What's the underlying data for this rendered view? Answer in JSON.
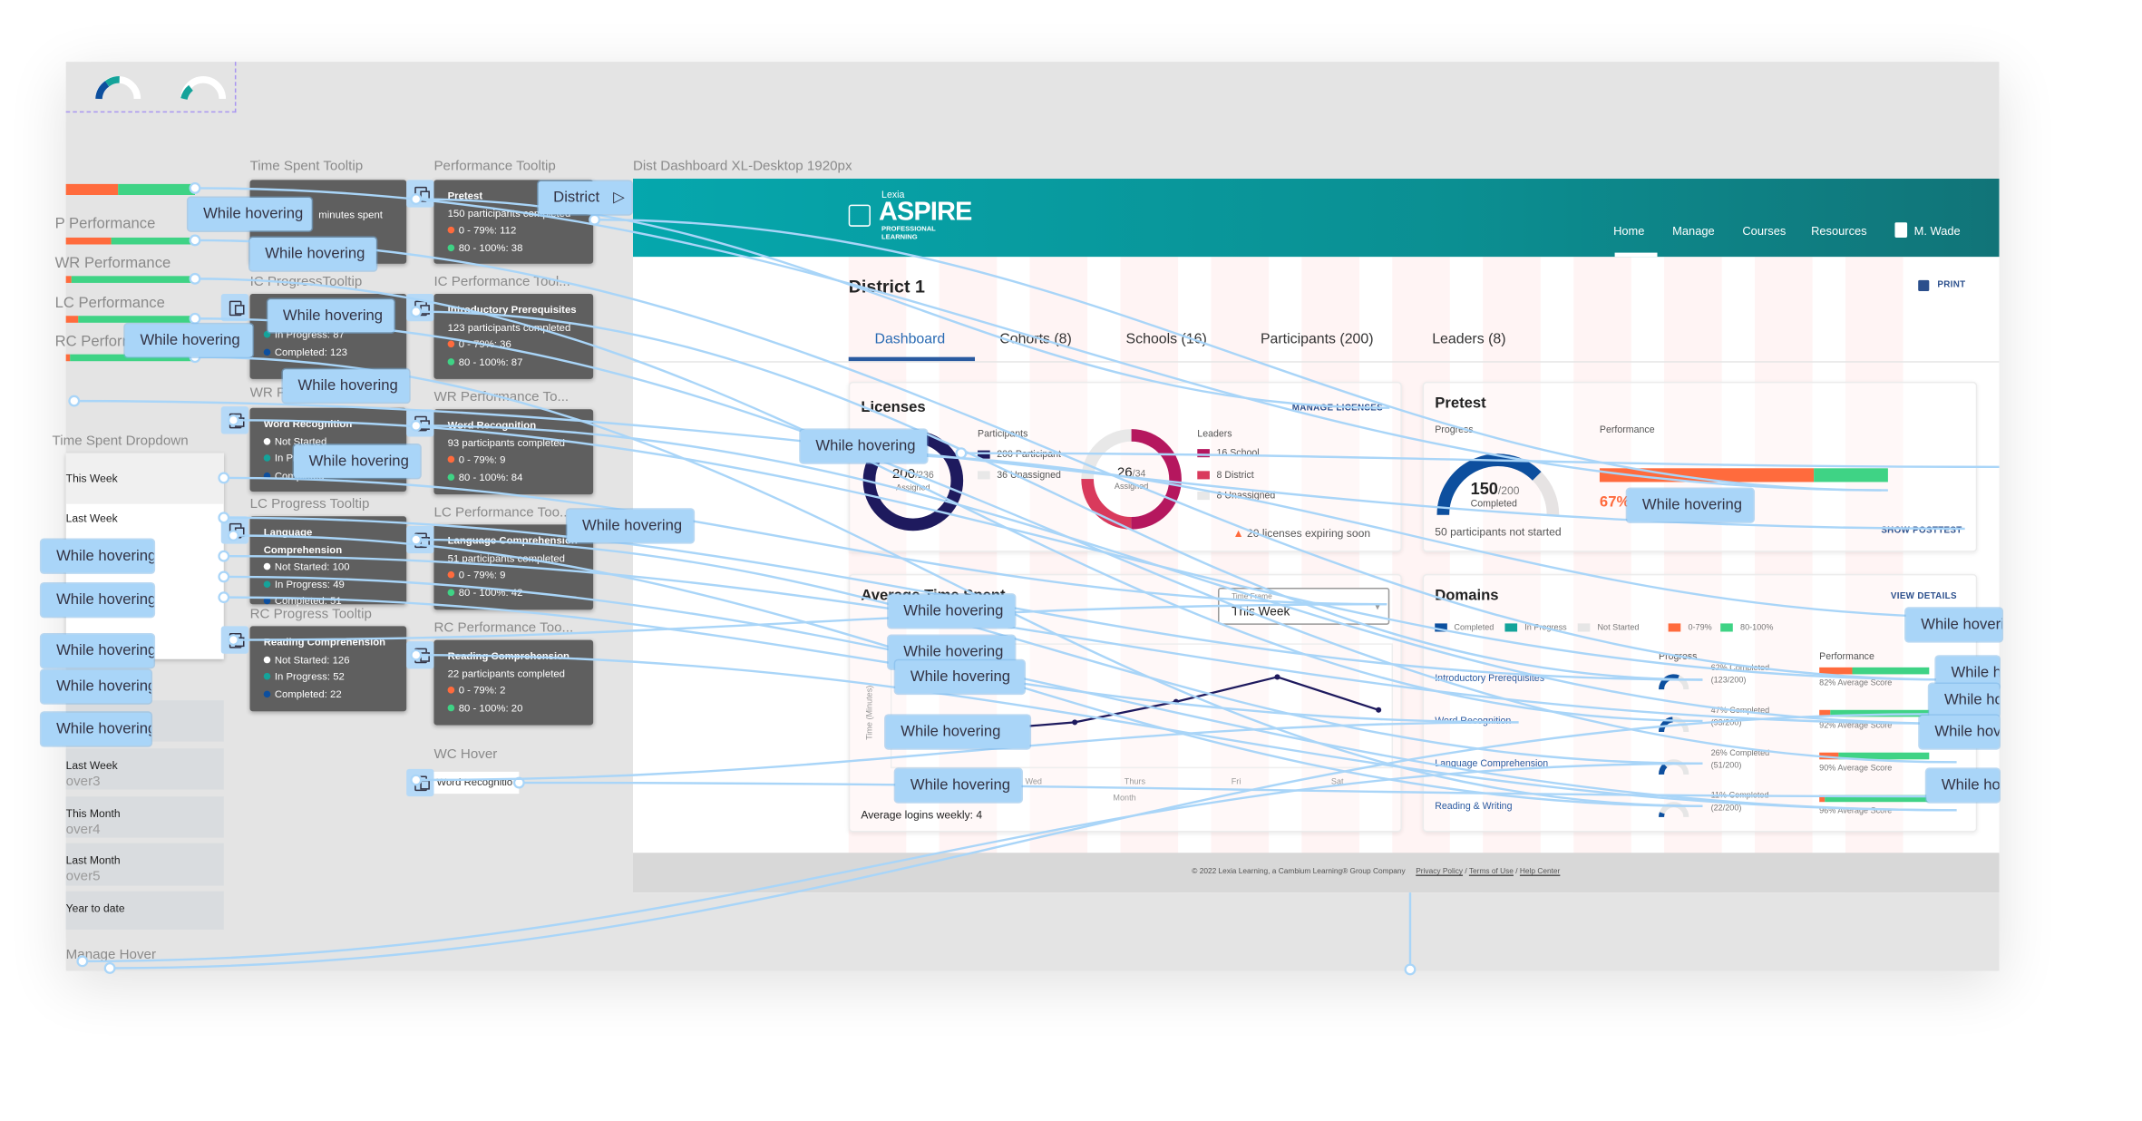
{
  "canvas": {
    "frame_title": "Dist Dashboard XL-Desktop 1920px",
    "hotspot_label": "While hovering",
    "flow_start_label": "District",
    "labels": {
      "time_spent_tooltip": "Time Spent Tooltip",
      "performance_tooltip": "Performance Tooltip",
      "ic_progress_tooltip": "IC ProgressTooltip",
      "ic_performance_tooltip": "IC Performance Tool...",
      "wr_progress_tooltip": "WR Progress Tooltip",
      "wr_performance_tooltip": "WR Performance To...",
      "lc_progress_tooltip": "LC Progress Tooltip",
      "lc_performance_tooltip": "LC Performance Too...",
      "rc_progress_tooltip": "RC Progress Tooltip",
      "rc_performance_tooltip": "RC Performance Too...",
      "wc_hover": "WC Hover",
      "time_spent_dropdown": "Time Spent Dropdown",
      "manage_hover": "Manage Hover",
      "p_performance": "P Performance",
      "wr_performance": "WR Performance",
      "lc_performance": "LC Performance",
      "rc_performance": "RC Performance"
    },
    "tooltips": {
      "time_spent": {
        "line2": "minutes spent"
      },
      "pretest_perf": {
        "title": "Pretest",
        "summary": "150 participants completed",
        "low": "0 - 79%: 112",
        "high": "80 - 100%: 38"
      },
      "ic_progress": {
        "in_progress": "In Progress: 87",
        "completed": "Completed: 123"
      },
      "ic_perf": {
        "title": "Introductory Prerequisites",
        "summary": "123 participants completed",
        "low": "0 - 79%: 36",
        "high": "80 - 100%: 87"
      },
      "wr_progress": {
        "title": "Word Recognition",
        "not_started": "Not Started",
        "in_progress": "In Progress",
        "completed": "Completed"
      },
      "wr_perf": {
        "title": "Word Recognition",
        "summary": "93 participants completed",
        "low": "0 - 79%: 9",
        "high": "80 - 100%: 84"
      },
      "lc_progress": {
        "title": "Language Comprehension",
        "not_started": "Not Started: 100",
        "in_progress": "In Progress: 49",
        "completed": "Completed: 51"
      },
      "lc_perf": {
        "title": "Language Comprehension",
        "summary": "51 participants completed",
        "low": "0 - 79%: 9",
        "high": "80 - 100%: 42"
      },
      "rc_progress": {
        "title": "Reading Comprehension",
        "not_started": "Not Started: 126",
        "in_progress": "In Progress: 52",
        "completed": "Completed: 22"
      },
      "rc_perf": {
        "title": "Reading Comprehension",
        "summary": "22 participants completed",
        "low": "0 - 79%: 2",
        "high": "80 - 100%: 20"
      },
      "wc_hover": {
        "title": "Word Recognitio"
      }
    },
    "dropdown": {
      "items": [
        "This Week",
        "Last Week"
      ]
    },
    "dropdown_rows": [
      {
        "label": "Last Week",
        "sub": "over3"
      },
      {
        "label": "This Month",
        "sub": "over4"
      },
      {
        "label": "Last Month",
        "sub": "over5"
      },
      {
        "label": "Year to date",
        "sub": ""
      }
    ],
    "colors": {
      "hotspot": "#a9d5f8",
      "wire": "#a9d5f8",
      "tooltip_bg": "#5f5f5f"
    }
  },
  "dashboard": {
    "logo": {
      "top": "Lexia",
      "main": "ASPIRE",
      "sub1": "PROFESSIONAL",
      "sub2": "LEARNING"
    },
    "nav": [
      "Home",
      "Manage",
      "Courses",
      "Resources"
    ],
    "user": "M. Wade",
    "page_title": "District 1",
    "print": "PRINT",
    "tabs": [
      "Dashboard",
      "Cohorts (8)",
      "Schools (16)",
      "Participants (200)",
      "Leaders (8)"
    ],
    "active_tab": 0,
    "licenses": {
      "title": "Licenses",
      "manage": "MANAGE LICENSES",
      "participants": {
        "big": "200",
        "total": "/236",
        "caption": "Assigned",
        "legend_title": "Participants",
        "legend": [
          "200 Participant",
          "36 Unassigned"
        ],
        "assigned": 200,
        "of": 236
      },
      "leaders": {
        "big": "26",
        "total": "/34",
        "caption": "Assigned",
        "legend_title": "Leaders",
        "legend": [
          "16 School",
          "8 District",
          "8 Unassigned"
        ],
        "values": [
          16,
          8,
          8
        ]
      },
      "warning": "20 licenses expiring soon"
    },
    "pretest": {
      "title": "Pretest",
      "progress_label": "Progress",
      "completed": "150",
      "total": "/200",
      "caption": "Completed",
      "not_started": "50 participants not started",
      "performance_label": "Performance",
      "low_share": 0.745,
      "pct": "67%",
      "show_posttest": "SHOW POSTTEST"
    },
    "time_spent": {
      "title": "Average Time Spent",
      "timeframe_label": "Time Frame",
      "timeframe_value": "This Week",
      "logins": "Average logins weekly: 4"
    },
    "domains": {
      "title": "Domains",
      "view_details": "VIEW DETAILS",
      "legend": [
        "Completed",
        "In Progress",
        "Not Started",
        "0-79%",
        "80-100%"
      ],
      "progress_header": "Progress",
      "performance_header": "Performance",
      "rows": [
        {
          "name": "Introductory Prerequisites",
          "completed": "62% Completed",
          "count": "(123/200)",
          "score": "82% Average Score",
          "low_share": 0.3
        },
        {
          "name": "Word Recognition",
          "completed": "47% Completed",
          "count": "(93/200)",
          "score": "92% Average Score",
          "low_share": 0.1
        },
        {
          "name": "Language Comprehension",
          "completed": "26% Completed",
          "count": "(51/200)",
          "score": "90% Average Score",
          "low_share": 0.18
        },
        {
          "name": "Reading & Writing",
          "completed": "11% Completed",
          "count": "(22/200)",
          "score": "96% Average Score",
          "low_share": 0.05
        }
      ]
    },
    "footer": {
      "copyright": "© 2022 Lexia Learning, a Cambium Learning® Group Company",
      "links": [
        "Privacy Policy",
        "Terms of Use",
        "Help Center"
      ]
    },
    "colors": {
      "teal": "#0aa2a8",
      "navy": "#1e1a5e",
      "magenta": "#b5175e",
      "blue": "#0d4f9e",
      "orange": "#ff6b3d",
      "green": "#3fd385",
      "inprogress": "#14a39a"
    }
  },
  "chart_data": {
    "type": "line",
    "title": "Average Time Spent",
    "xlabel": "Month",
    "ylabel": "Time (Minutes)",
    "categories": [
      "Tues",
      "Wed",
      "Thurs",
      "Fri",
      "Sat"
    ],
    "values": [
      9,
      11,
      16,
      22,
      14
    ],
    "ylim": [
      0,
      30
    ],
    "grid": true
  }
}
